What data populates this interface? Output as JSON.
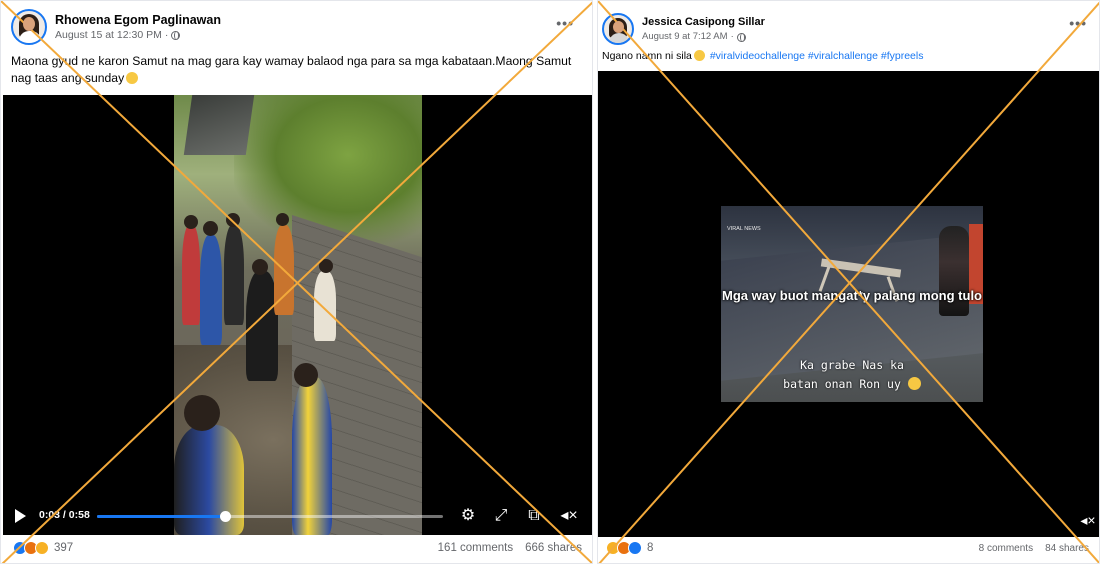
{
  "posts": [
    {
      "author": "Rhowena Egom Paglinawan",
      "date": "August 15 at 12:30 PM",
      "caption": "Maona gyud ne karon Samut na mag gara kay wamay balaod nga para sa mga kabataan.Maong Samut nag taas ang sunday",
      "video": {
        "time": "0:03 / 0:58",
        "progress": 0.37
      },
      "reaction_count": "397",
      "comments": "161 comments",
      "shares": "666 shares"
    },
    {
      "author": "Jessica Casipong Sillar",
      "date": "August 9 at 7:12 AM",
      "caption": "Ngano namn ni sila",
      "hashtags": [
        "#viralvideochallenge",
        "#viralchallenge",
        "#fypreels"
      ],
      "video": {
        "watermark": "VIRAL NEWS",
        "overlay_title": "Mga way buot mangat*y palang mong tulo",
        "overlay_sub1": "Ka grabe Nas ka",
        "overlay_sub2": "batan onan Ron uy"
      },
      "reaction_count": "8",
      "comments": "8 comments",
      "shares": "84 shares"
    }
  ],
  "icons": {
    "more": "more-options-icon",
    "globe": "globe-icon",
    "play": "play-icon",
    "settings": "gear-icon",
    "fullscreen": "expand-icon",
    "pip": "picture-in-picture-icon",
    "mute": "speaker-muted-icon"
  },
  "colors": {
    "x_overlay": "#f2a93b",
    "link": "#1877f2"
  }
}
